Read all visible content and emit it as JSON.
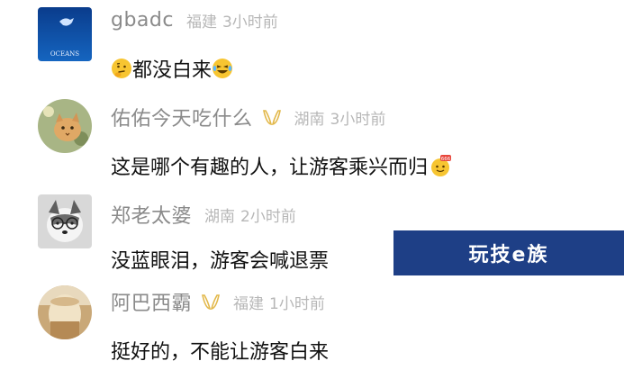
{
  "comments": [
    {
      "username": "gbadc",
      "region": "福建",
      "time": "3小时前",
      "text": "都没白来",
      "avatar_caption": "OCEANS",
      "emoji_before": "thinking-face-emoji",
      "emoji_after": "laughing-tears-emoji"
    },
    {
      "username": "佑佑今天吃什么",
      "region": "湖南",
      "time": "3小时前",
      "text": "这是哪个有趣的人，让游客乘兴而归",
      "badge": "vip-badge-icon",
      "emoji_after": "666-emoji"
    },
    {
      "username": "郑老太婆",
      "region": "湖南",
      "time": "2小时前",
      "text": "没蓝眼泪，游客会喊退票"
    },
    {
      "username": "阿巴西霸",
      "region": "福建",
      "time": "1小时前",
      "text": "挺好的，不能让游客白来",
      "badge": "vip-badge-icon"
    }
  ],
  "watermark": {
    "text": "玩技e族"
  },
  "colors": {
    "username": "#8a8a8a",
    "meta": "#b7b7b7",
    "text": "#111111",
    "badge": "#e2b84a",
    "watermark_bg": "#1e3f86"
  }
}
